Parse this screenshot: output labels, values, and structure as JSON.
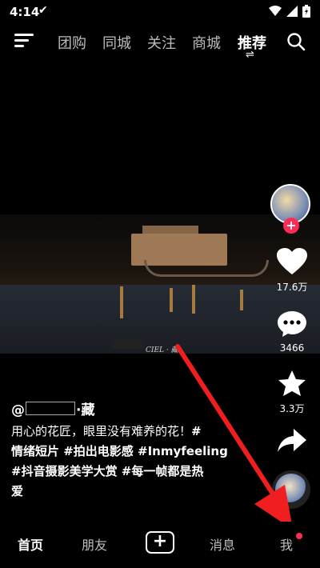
{
  "status_bar": {
    "time": "4:14",
    "check_icon": "check-icon",
    "icons": [
      "wifi-icon",
      "signal-icon",
      "battery-icon"
    ]
  },
  "top_nav": {
    "menu_icon": "menu-icon",
    "tabs": [
      "团购",
      "同城",
      "关注",
      "商城",
      "推荐"
    ],
    "active_tab": "推荐",
    "swap_glyph": "⇌",
    "search_icon": "search-icon"
  },
  "sidebar": {
    "likes": "17.6万",
    "comments": "3466",
    "favorites": "3.3万",
    "follow_glyph": "+"
  },
  "video": {
    "watermark": "CIEL · 藏"
  },
  "post": {
    "author": "@",
    "author_suffix": "·藏",
    "line1_text": "用心的花匠，眼里没有难养的花！",
    "line1_tag": "#",
    "line2_tags": "情绪短片 #拍出电影感 #Inmyfeeling",
    "line3_tags": "#抖音摄影美学大赏 #每一帧都是热",
    "line4_tags": "爱"
  },
  "bottom_nav": {
    "items": [
      "首页",
      "朋友",
      "消息",
      "我"
    ],
    "active": "首页",
    "plus_glyph": "+"
  },
  "colors": {
    "accent": "#fe2c55",
    "arrow": "#f01e1e"
  }
}
